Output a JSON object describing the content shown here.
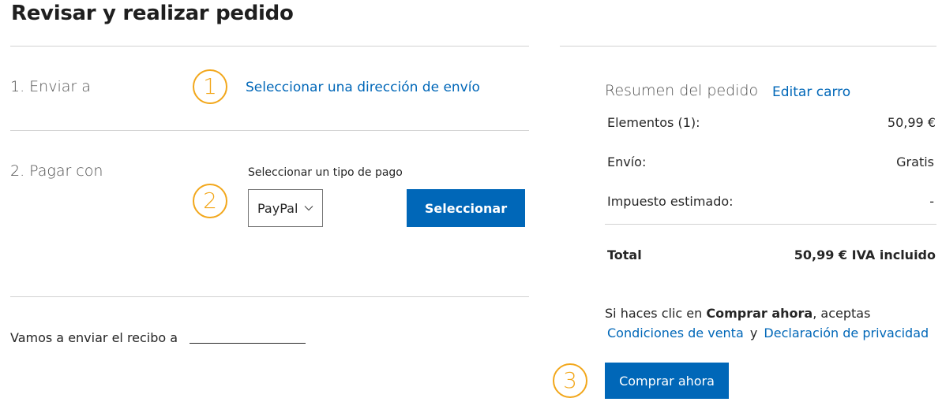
{
  "page": {
    "title": "Revisar y realizar pedido"
  },
  "steps": {
    "ship": {
      "number": "1",
      "label": "1. Enviar a",
      "link": "Seleccionar una dirección de envío"
    },
    "pay": {
      "number": "2",
      "label": "2. Pagar con",
      "select_caption": "Seleccionar un tipo de pago",
      "selected_option": "PayPal",
      "select_button": "Seleccionar"
    },
    "buy": {
      "number": "3"
    }
  },
  "receipt": {
    "label": "Vamos a enviar el recibo a"
  },
  "summary": {
    "title": "Resumen del pedido",
    "edit_link": "Editar carro",
    "rows": [
      {
        "label": "Elementos (1):",
        "value": "50,99 €"
      },
      {
        "label": "Envío:",
        "value": "Gratis"
      },
      {
        "label": "Impuesto estimado:",
        "value": "-"
      }
    ],
    "total": {
      "label": "Total",
      "value": "50,99 € IVA incluido"
    },
    "terms": {
      "prefix": "Si haces clic en ",
      "emphasis": "Comprar ahora",
      "suffix": ", aceptas",
      "link_sales": "Condiciones de venta",
      "and": "y",
      "link_privacy": "Declaración de privacidad"
    },
    "buy_button": "Comprar ahora"
  },
  "colors": {
    "accent": "#0067b8",
    "badge": "#f2a71b",
    "rule": "#d2d2d2"
  }
}
